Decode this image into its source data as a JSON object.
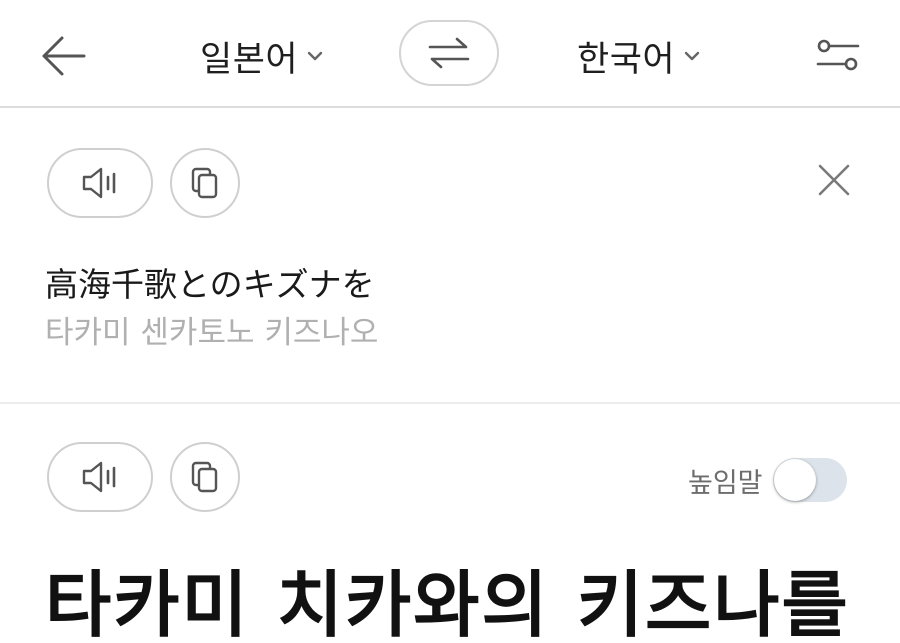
{
  "header": {
    "back_icon": "arrow-left-icon",
    "source_language": "일본어",
    "target_language": "한국어",
    "swap_icon": "swap-arrows-icon",
    "settings_icon": "sliders-icon",
    "dropdown_icon": "chevron-down-icon"
  },
  "source": {
    "speak_icon": "speaker-icon",
    "copy_icon": "copy-icon",
    "clear_icon": "close-icon",
    "text": "高海千歌とのキズナを",
    "pronunciation": "타카미 센카토노 키즈나오"
  },
  "result": {
    "speak_icon": "speaker-icon",
    "copy_icon": "copy-icon",
    "honorific_label": "높임말",
    "honorific_on": false,
    "text": "타카미 치카와의 키즈나를"
  },
  "colors": {
    "icon": "#555555",
    "divider": "#dcdcdc",
    "pronunciation": "#b0b0b0",
    "toggle_track": "#dce3ea"
  }
}
